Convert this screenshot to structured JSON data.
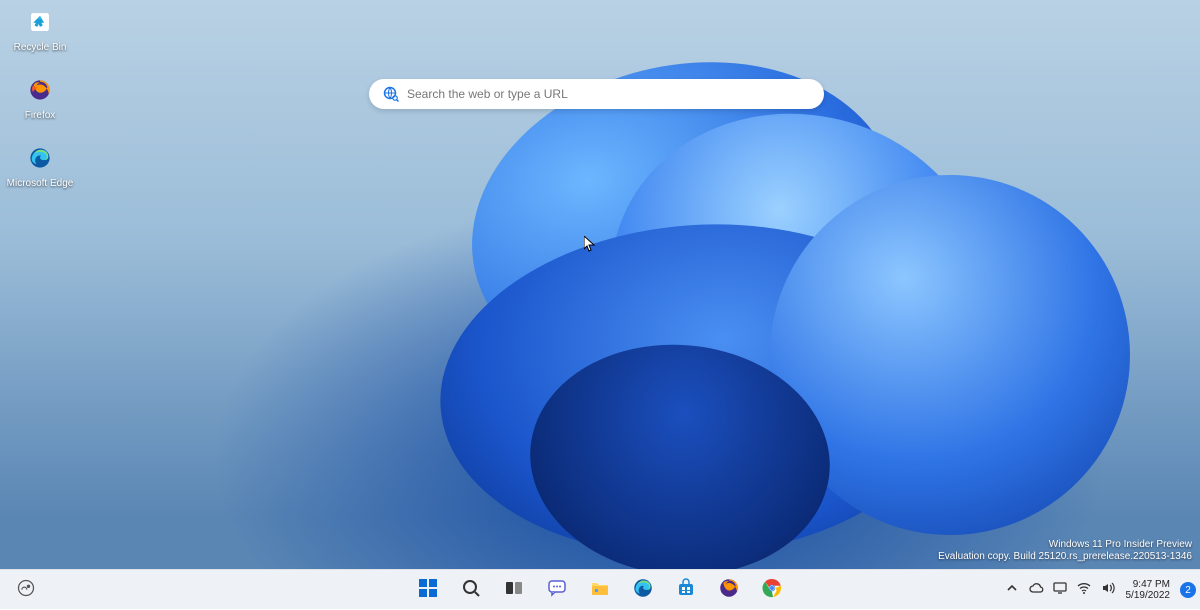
{
  "desktop_icons": [
    {
      "name": "recycle-bin",
      "label": "Recycle Bin"
    },
    {
      "name": "firefox",
      "label": "Firefox"
    },
    {
      "name": "edge",
      "label": "Microsoft Edge"
    }
  ],
  "search": {
    "placeholder": "Search the web or type a URL",
    "value": ""
  },
  "watermark": {
    "line1": "Windows 11 Pro Insider Preview",
    "line2": "Evaluation copy. Build 25120.rs_prerelease.220513-1346"
  },
  "taskbar": {
    "left": [
      {
        "name": "weather-widget",
        "icon": "weather"
      }
    ],
    "center": [
      {
        "name": "start-button",
        "icon": "start"
      },
      {
        "name": "search-button",
        "icon": "search"
      },
      {
        "name": "task-view-button",
        "icon": "taskview"
      },
      {
        "name": "chat-button",
        "icon": "chat"
      },
      {
        "name": "file-explorer-button",
        "icon": "explorer"
      },
      {
        "name": "edge-button",
        "icon": "edge"
      },
      {
        "name": "store-button",
        "icon": "store"
      },
      {
        "name": "firefox-button",
        "icon": "firefox"
      },
      {
        "name": "chrome-button",
        "icon": "chrome"
      }
    ],
    "tray": [
      {
        "name": "tray-overflow",
        "icon": "chevron-up"
      },
      {
        "name": "tray-onedrive",
        "icon": "cloud"
      },
      {
        "name": "tray-vm",
        "icon": "monitor"
      },
      {
        "name": "tray-network",
        "icon": "wifi"
      },
      {
        "name": "tray-volume",
        "icon": "volume"
      }
    ],
    "clock": {
      "time": "9:47 PM",
      "date": "5/19/2022"
    },
    "notifications": {
      "count": "2"
    }
  }
}
